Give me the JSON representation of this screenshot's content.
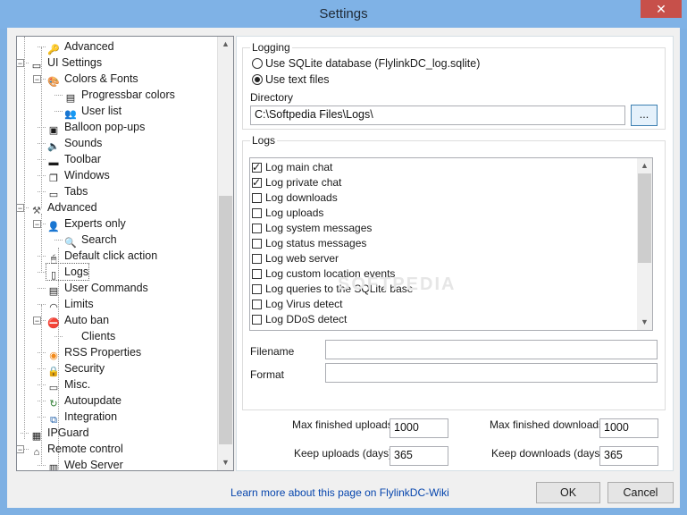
{
  "window": {
    "title": "Settings",
    "close_glyph": "✕"
  },
  "tree": {
    "items": [
      {
        "label": "Advanced",
        "icon": "key-icon"
      },
      {
        "label": "UI Settings",
        "icon": "window-icon"
      },
      {
        "label": "Colors & Fonts",
        "icon": "palette-icon"
      },
      {
        "label": "Progressbar colors",
        "icon": "list-icon"
      },
      {
        "label": "User list",
        "icon": "users-icon"
      },
      {
        "label": "Balloon pop-ups",
        "icon": "balloon-icon"
      },
      {
        "label": "Sounds",
        "icon": "speaker-icon"
      },
      {
        "label": "Toolbar",
        "icon": "toolbar-icon"
      },
      {
        "label": "Windows",
        "icon": "windows-icon"
      },
      {
        "label": "Tabs",
        "icon": "tabs-icon"
      },
      {
        "label": "Advanced",
        "icon": "tools-icon"
      },
      {
        "label": "Experts only",
        "icon": "user-icon"
      },
      {
        "label": "Search",
        "icon": "magnifier-icon"
      },
      {
        "label": "Default click action",
        "icon": "mouse-icon"
      },
      {
        "label": "Logs",
        "icon": "document-icon"
      },
      {
        "label": "User Commands",
        "icon": "commands-icon"
      },
      {
        "label": "Limits",
        "icon": "gauge-icon"
      },
      {
        "label": "Auto ban",
        "icon": "ban-icon"
      },
      {
        "label": "Clients",
        "icon": ""
      },
      {
        "label": "RSS Properties",
        "icon": "rss-icon"
      },
      {
        "label": "Security",
        "icon": "lock-icon"
      },
      {
        "label": "Misc.",
        "icon": "monitor-icon"
      },
      {
        "label": "Autoupdate",
        "icon": "update-icon"
      },
      {
        "label": "Integration",
        "icon": "integration-icon"
      },
      {
        "label": "IPGuard",
        "icon": "ipguard-icon"
      },
      {
        "label": "Remote control",
        "icon": "network-icon"
      },
      {
        "label": "Web Server",
        "icon": "server-icon"
      }
    ]
  },
  "logging": {
    "group_label": "Logging",
    "option_sqlite": "Use SQLite database (FlylinkDC_log.sqlite)",
    "option_text": "Use text files",
    "directory_label": "Directory",
    "directory_value": "C:\\Softpedia Files\\Logs\\",
    "browse_label": "..."
  },
  "logs": {
    "group_label": "Logs",
    "items": [
      {
        "label": "Log main chat",
        "checked": true
      },
      {
        "label": "Log private chat",
        "checked": true
      },
      {
        "label": "Log downloads",
        "checked": false
      },
      {
        "label": "Log uploads",
        "checked": false
      },
      {
        "label": "Log system messages",
        "checked": false
      },
      {
        "label": "Log status messages",
        "checked": false
      },
      {
        "label": "Log web server",
        "checked": false
      },
      {
        "label": "Log custom location events",
        "checked": false
      },
      {
        "label": "Log queries to the SQLite base",
        "checked": false
      },
      {
        "label": "Log Virus detect",
        "checked": false
      },
      {
        "label": "Log DDoS detect",
        "checked": false
      }
    ],
    "filename_label": "Filename",
    "format_label": "Format",
    "watermark": "SOFTPEDIA"
  },
  "limits": {
    "max_uploads_label": "Max finished uploads",
    "max_uploads_value": "1000",
    "max_downloads_label": "Max finished downloads",
    "max_downloads_value": "1000",
    "keep_uploads_label": "Keep uploads (days)",
    "keep_uploads_value": "365",
    "keep_downloads_label": "Keep downloads (days)",
    "keep_downloads_value": "365"
  },
  "footer": {
    "help_link": "Learn more about this page on FlylinkDC-Wiki",
    "ok_label": "OK",
    "cancel_label": "Cancel"
  }
}
